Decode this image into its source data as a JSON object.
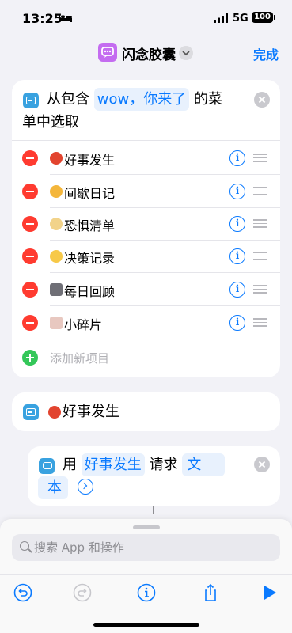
{
  "status": {
    "time": "13:25",
    "network": "5G",
    "battery": "100"
  },
  "nav": {
    "title": "闪念胶囊",
    "done": "完成"
  },
  "menu_action": {
    "prefix": "从包含",
    "token": "wow，你来了",
    "suffix_line1": "的菜",
    "line2": "单中选取",
    "items": [
      {
        "label": "好事发生",
        "emoji": "tomato",
        "color": "#e2442f"
      },
      {
        "label": "间歇日记",
        "emoji": "cat",
        "color": "#f4b63b"
      },
      {
        "label": "恐惧清单",
        "emoji": "face",
        "color": "#f2d38a"
      },
      {
        "label": "决策记录",
        "emoji": "chick",
        "color": "#f7c948"
      },
      {
        "label": "每日回顾",
        "emoji": "printer",
        "color": "#6f6f76"
      },
      {
        "label": "小碎片",
        "emoji": "eraser",
        "color": "#e8c8c0"
      }
    ],
    "add_item": "添加新项目"
  },
  "menu_case": {
    "label": "好事发生"
  },
  "ask_action": {
    "prefix": "用",
    "token1": "好事发生",
    "mid": "请求",
    "token2_a": "文",
    "token2_b": "本"
  },
  "sheet": {
    "search_placeholder": "搜索 App 和操作"
  }
}
